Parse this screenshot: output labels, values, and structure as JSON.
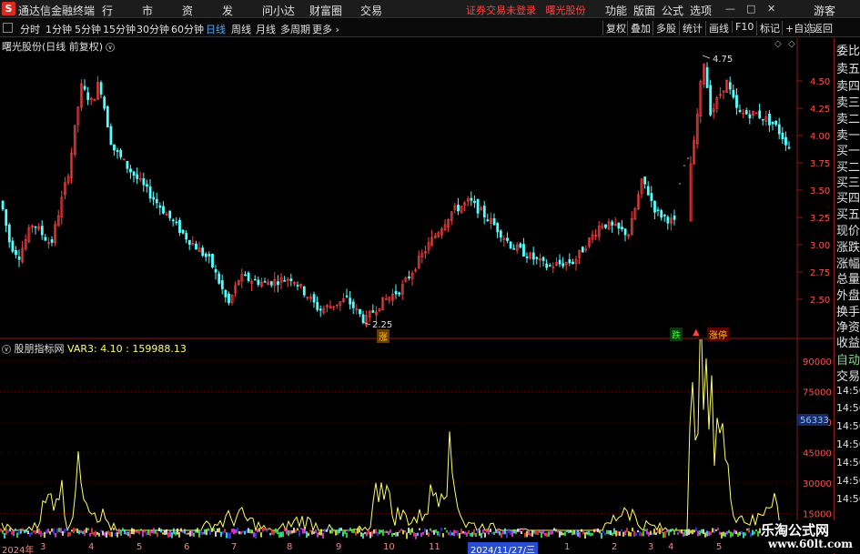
{
  "app": {
    "title": "通达信金融终端",
    "logo_icon": "tdx-logo-icon",
    "menu": [
      "行情",
      "市场",
      "资讯",
      "发现",
      "问小达",
      "财富圈",
      "交易"
    ],
    "notice": "证券交易未登录   曙光股份",
    "right_menu": [
      "功能",
      "版面",
      "公式",
      "选项"
    ],
    "guest": "游客",
    "accent_color": "#d62d20"
  },
  "period_bar": {
    "periods": [
      "分时",
      "1分钟",
      "5分钟",
      "15分钟",
      "30分钟",
      "60分钟",
      "日线",
      "周线",
      "月线",
      "多周期",
      "更多"
    ],
    "active_period": "日线",
    "tools": [
      "复权",
      "叠加",
      "多股",
      "统计",
      "画线",
      "F10",
      "标记",
      "+自选",
      "返回"
    ]
  },
  "main_chart": {
    "title": "曙光股份(日线 前复权)",
    "price_axis": [
      "4.50",
      "4.25",
      "4.00",
      "3.75",
      "3.50",
      "3.25",
      "3.00",
      "2.75",
      "2.50"
    ],
    "high_label": "4.75",
    "low_label": "2.25",
    "up_color": "#ff4040",
    "down_color": "#54ffff",
    "markers": [
      {
        "text": "涨",
        "color": "#ffcc00"
      },
      {
        "text": "跌",
        "color": "#33ff33"
      },
      {
        "text": "涨停",
        "color": "#ff4040"
      }
    ]
  },
  "indicator": {
    "name": "股朋指标网",
    "var_label": "VAR3: 4.10 : 159988.13",
    "axis": [
      "90000",
      "75000",
      "60000",
      "45000",
      "30000",
      "15000"
    ],
    "cursor_value": "56333",
    "line_color": "#ffff66"
  },
  "quote_panel": {
    "items": [
      "委比",
      "卖五",
      "卖四",
      "卖三",
      "卖二",
      "卖一",
      "买一",
      "买二",
      "买三",
      "买四",
      "买五",
      "现价",
      "涨跌",
      "涨幅",
      "总量",
      "外盘",
      "换手",
      "净资",
      "收益"
    ],
    "auto": "自动",
    "trade": "交易",
    "times": [
      "14:56",
      "14:56",
      "14:56",
      "14:56",
      "14:56",
      "14:56",
      "14:56"
    ]
  },
  "date_axis": {
    "year": "2024年",
    "months": [
      "3",
      "4",
      "5",
      "6",
      "7",
      "8",
      "9",
      "10",
      "11",
      "12",
      "1",
      "2",
      "3",
      "4",
      "5"
    ],
    "cursor_date": "2024/11/27/三"
  },
  "watermark": {
    "line1": "乐淘公式网",
    "line2": "www.60lt.com"
  }
}
